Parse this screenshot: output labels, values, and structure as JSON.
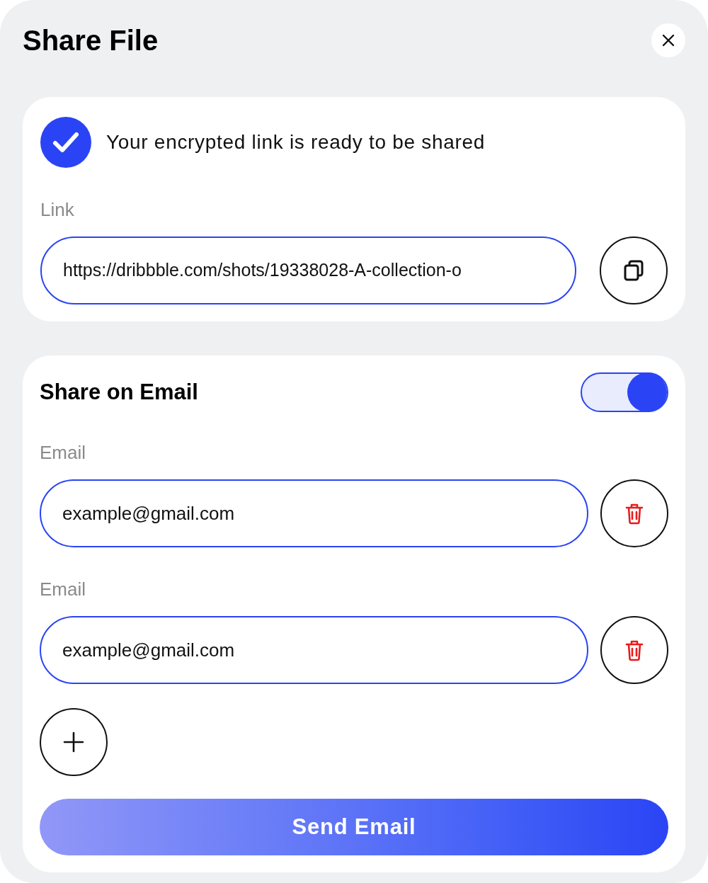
{
  "dialog": {
    "title": "Share File"
  },
  "link_card": {
    "message": "Your encrypted link is ready to be shared",
    "label": "Link",
    "value": "https://dribbble.com/shots/19338028-A-collection-o"
  },
  "email_card": {
    "title": "Share on Email",
    "toggle": {
      "on": true
    },
    "emails": [
      {
        "label": "Email",
        "value": "example@gmail.com"
      },
      {
        "label": "Email",
        "value": "example@gmail.com"
      }
    ],
    "send_button": "Send Email"
  }
}
